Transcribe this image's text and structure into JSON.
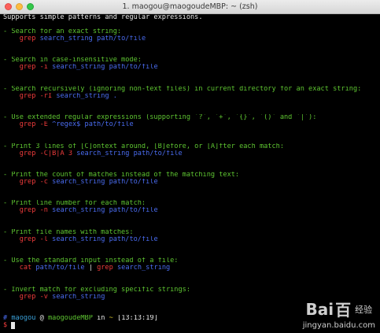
{
  "window": {
    "title": "1. maogou@maogoudeMBP: ~ (zsh)"
  },
  "terminal": {
    "intro": "Supports simple patterns and regular expressions.",
    "sections": [
      {
        "comment": "- Search for an exact string:",
        "cmd": "grep",
        "args": "search_string path/to/file"
      },
      {
        "comment": "- Search in case-insensitive mode:",
        "cmd": "grep",
        "flags": "-i",
        "args": "search_string path/to/file"
      },
      {
        "comment": "- Search recursively (ignoring non-text files) in current directory for an exact string:",
        "cmd": "grep",
        "flags": "-rI",
        "args": "search_string ."
      },
      {
        "comment": "- Use extended regular expressions (supporting `?`, `+`, `{}`, `()` and `|`):",
        "cmd": "grep",
        "flags": "-E",
        "args": "^regex$ path/to/file"
      },
      {
        "comment": "- Print 3 lines of [C]ontext around, [B]efore, or [A]fter each match:",
        "cmd": "grep",
        "flags": "-C|B|A",
        "num": "3",
        "args": "search_string path/to/file"
      },
      {
        "comment": "- Print the count of matches instead of the matching text:",
        "cmd": "grep",
        "flags": "-c",
        "args": "search_string path/to/file"
      },
      {
        "comment": "- Print line number for each match:",
        "cmd": "grep",
        "flags": "-n",
        "args": "search_string path/to/file"
      },
      {
        "comment": "- Print file names with matches:",
        "cmd": "grep",
        "flags": "-l",
        "args": "search_string path/to/file"
      },
      {
        "comment": "- Use the standard input instead of a file:",
        "cmd": "cat",
        "args": "path/to/file",
        "pipe": "|",
        "cmd2": "grep",
        "args2": "search_string"
      },
      {
        "comment": "- Invert match for excluding specific strings:",
        "cmd": "grep",
        "flags": "-v",
        "args": "search_string"
      }
    ],
    "prompt": {
      "hash": "#",
      "user": "maogou",
      "at": "@",
      "host": "maogoudeMBP",
      "in": "in",
      "dir": "~",
      "time": "[13:13:19]",
      "symbol": "$"
    }
  },
  "watermark": {
    "brand": "Bai",
    "brand2": "百",
    "cn": "经验",
    "url": "jingyan.baidu.com"
  },
  "colors": {
    "comment": "#5ec531",
    "command": "#ee3b3b",
    "argument": "#4a6cf0"
  }
}
